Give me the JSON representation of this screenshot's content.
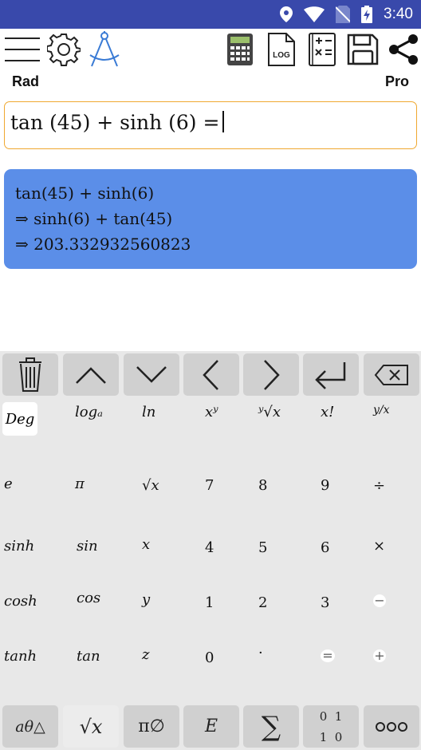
{
  "status_bar": {
    "time": "3:40",
    "icons": [
      "location-icon",
      "wifi-icon",
      "no-sim-icon",
      "battery-charging-icon"
    ]
  },
  "toolbar": {
    "left_icons": [
      "menu-icon",
      "gear-icon",
      "compass-icon"
    ],
    "right_icons": [
      "calculator-icon",
      "log-file-icon",
      "formula-book-icon",
      "save-icon",
      "share-icon"
    ],
    "log_label": "LOG"
  },
  "modes": {
    "angle": "Rad",
    "edition": "Pro"
  },
  "input": {
    "expression": "tan (45) + sinh (6) ="
  },
  "result": {
    "lines": [
      "tan(45) + sinh(6)",
      "⇒ sinh(6) + tan(45)",
      "⇒ 203.332932560823"
    ]
  },
  "keyboard": {
    "nav": [
      "trash-icon",
      "up-arrow-icon",
      "down-arrow-icon",
      "left-arrow-icon",
      "right-arrow-icon",
      "enter-icon",
      "backspace-icon"
    ],
    "deg": "Deg",
    "rows": [
      [
        "",
        "logₐ",
        "ln",
        "xʸ",
        "ʸ√x",
        "x!",
        "y/x"
      ],
      [
        "e",
        "π",
        "√x",
        "7",
        "8",
        "9",
        "÷"
      ],
      [
        "sinh",
        "sin",
        "x",
        "4",
        "5",
        "6",
        "×"
      ],
      [
        "cosh",
        "cos",
        "y",
        "1",
        "2",
        "3",
        "−"
      ],
      [
        "tanh",
        "tan",
        "z",
        "0",
        "·",
        "=",
        "+"
      ]
    ],
    "bottom": [
      "aθ△",
      "√x",
      "π∅",
      "E",
      "∑",
      "0 1 / 1 0",
      "ooo"
    ],
    "bottom_labels": {
      "greek": "aθ△",
      "root": "√x",
      "pi_empty": "π∅",
      "e_key": "E",
      "sum": "∑",
      "bin_top": "0  1",
      "bin_bottom": "1  0"
    }
  }
}
